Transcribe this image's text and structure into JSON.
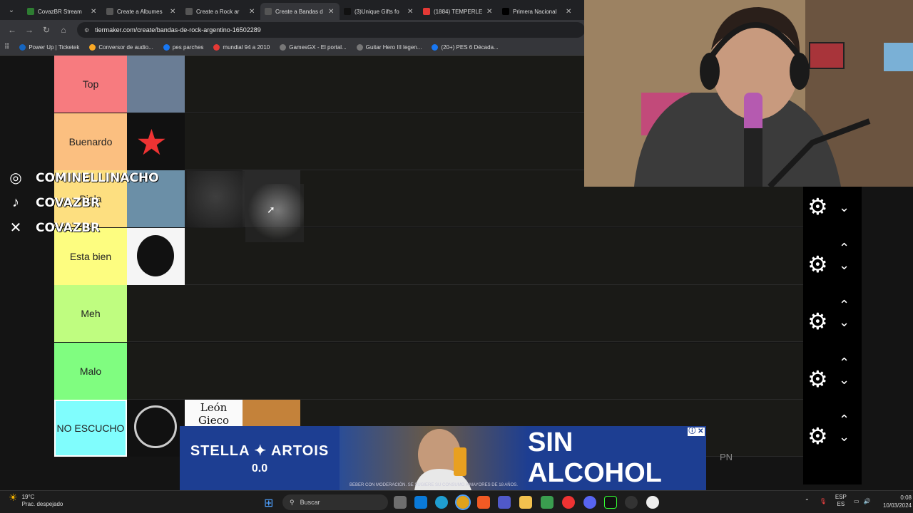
{
  "browser": {
    "tabs": [
      {
        "title": "CovazBR Stream",
        "color": "#2e7d32"
      },
      {
        "title": "Create a Albumes",
        "color": "#555"
      },
      {
        "title": "Create a Rock ar",
        "color": "#555"
      },
      {
        "title": "Create a Bandas d",
        "color": "#555",
        "active": true
      },
      {
        "title": "(3)Unique Gifts fo",
        "color": "#111"
      },
      {
        "title": "(1884) TEMPERLE",
        "color": "#e53935"
      },
      {
        "title": "Primera Nacional",
        "color": "#000"
      }
    ],
    "url": "tiermaker.com/create/bandas-de-rock-argentino-16502289",
    "bookmarks": [
      {
        "label": "Power Up | Ticketek",
        "color": "#1565c0"
      },
      {
        "label": "Conversor de audio...",
        "color": "#f9a825"
      },
      {
        "label": "pes parches",
        "color": "#1877f2"
      },
      {
        "label": "mundial 94 a 2010",
        "color": "#e53935"
      },
      {
        "label": "GamesGX - El portal...",
        "color": "#777"
      },
      {
        "label": "Guitar Hero III legen...",
        "color": "#777"
      },
      {
        "label": "(20+) PES 6 Década...",
        "color": "#1877f2"
      }
    ]
  },
  "tiers": [
    {
      "label": "Top",
      "color": "#f77b7f",
      "items": [
        "#6a7d95",
        null
      ]
    },
    {
      "label": "Buenardo",
      "color": "#fbbf80",
      "items": [
        "#111111"
      ]
    },
    {
      "label": "Piola",
      "color": "#fddf80",
      "items": [
        "#6b8fa7",
        "#1e1e1e",
        "#2a2a2a"
      ]
    },
    {
      "label": "Esta bien",
      "color": "#fdfd80",
      "items": [
        "#f5f5f5"
      ]
    },
    {
      "label": "Meh",
      "color": "#bffd80",
      "items": []
    },
    {
      "label": "Malo",
      "color": "#80fd80",
      "items": []
    },
    {
      "label": "NO ESCUCHO",
      "color": "#80fdfd",
      "items": [
        "#111111",
        "#fafafa",
        "#c4823a"
      ]
    }
  ],
  "dragged_item_text": "León Gieco",
  "social": [
    {
      "icon": "instagram-icon",
      "glyph": "◎",
      "handle": "COMINELLINACHO"
    },
    {
      "icon": "tiktok-icon",
      "glyph": "♪",
      "handle": "COVAZBR"
    },
    {
      "icon": "x-icon",
      "glyph": "✕",
      "handle": "COVAZBR"
    }
  ],
  "ad": {
    "brand": "STELLA ✦ ARTOIS",
    "sub": "0.0",
    "headline": "SIN ALCOHOL",
    "disclaimer": "BEBER CON MODERACIÓN. SE SUGIERE SU CONSUMO A MAYORES DE 18 AÑOS.",
    "close_label": "ⓘ ✕"
  },
  "pn_text": "PN",
  "taskbar": {
    "weather_temp": "19°C",
    "weather_desc": "Prac. despejado",
    "search_placeholder": "Buscar",
    "lang": "ESP",
    "region": "ES",
    "time": "0:08",
    "date": "10/03/2024"
  }
}
